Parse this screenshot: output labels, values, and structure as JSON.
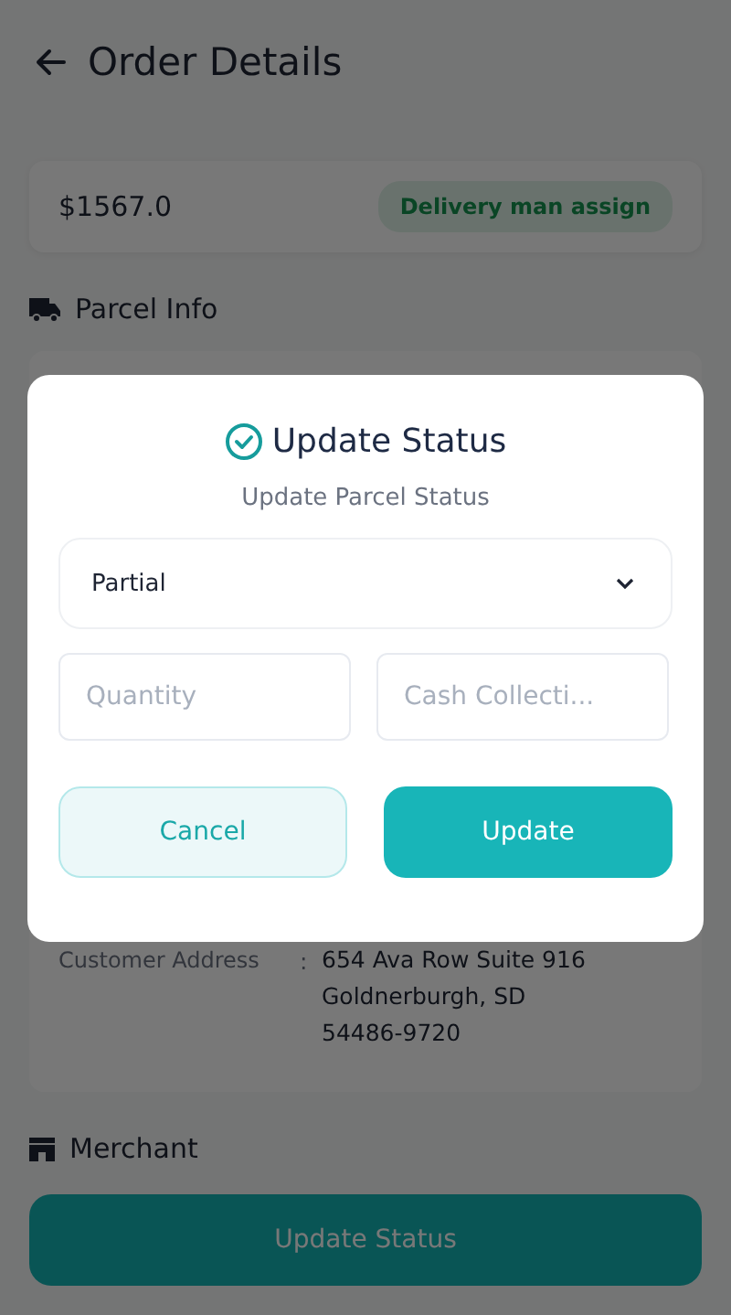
{
  "header": {
    "title": "Order Details"
  },
  "summary": {
    "amount": "$1567.0",
    "status_badge": "Delivery man assign"
  },
  "parcel_info": {
    "title": "Parcel Info",
    "rows": [
      {
        "label": "Customer Address",
        "separator": ":",
        "lines": [
          "654 Ava Row Suite 916",
          "Goldnerburgh, SD",
          "54486-9720"
        ]
      }
    ]
  },
  "merchant": {
    "title": "Merchant"
  },
  "primary_button": {
    "label": "Update Status"
  },
  "dialog": {
    "title": "Update Status",
    "subtitle": "Update Parcel Status",
    "status_select": {
      "value": "Partial"
    },
    "quantity": {
      "placeholder": "Quantity"
    },
    "cash_collection": {
      "placeholder": "Cash Collecti..."
    },
    "buttons": [
      {
        "label": "Cancel",
        "kind": "secondary"
      },
      {
        "label": "Update",
        "kind": "primary"
      }
    ]
  }
}
